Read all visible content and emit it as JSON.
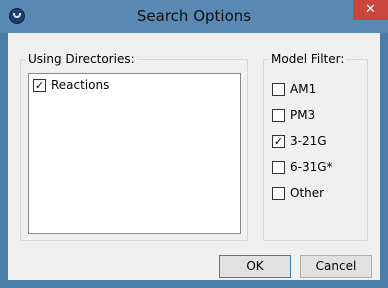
{
  "window": {
    "title": "Search Options",
    "close_label": "✕"
  },
  "directories": {
    "label": "Using Directories:",
    "items": [
      {
        "label": "Reactions",
        "checked": true
      }
    ]
  },
  "model_filter": {
    "label": "Model Filter:",
    "options": [
      {
        "label": "AM1",
        "checked": false
      },
      {
        "label": "PM3",
        "checked": false
      },
      {
        "label": "3-21G",
        "checked": true
      },
      {
        "label": "6-31G*",
        "checked": false
      },
      {
        "label": "Other",
        "checked": false
      }
    ]
  },
  "buttons": {
    "ok_label": "OK",
    "cancel_label": "Cancel"
  },
  "colors": {
    "titlebar": "#5a8ab3",
    "close_button": "#c9463d",
    "dialog_background": "#f0f0f0"
  }
}
